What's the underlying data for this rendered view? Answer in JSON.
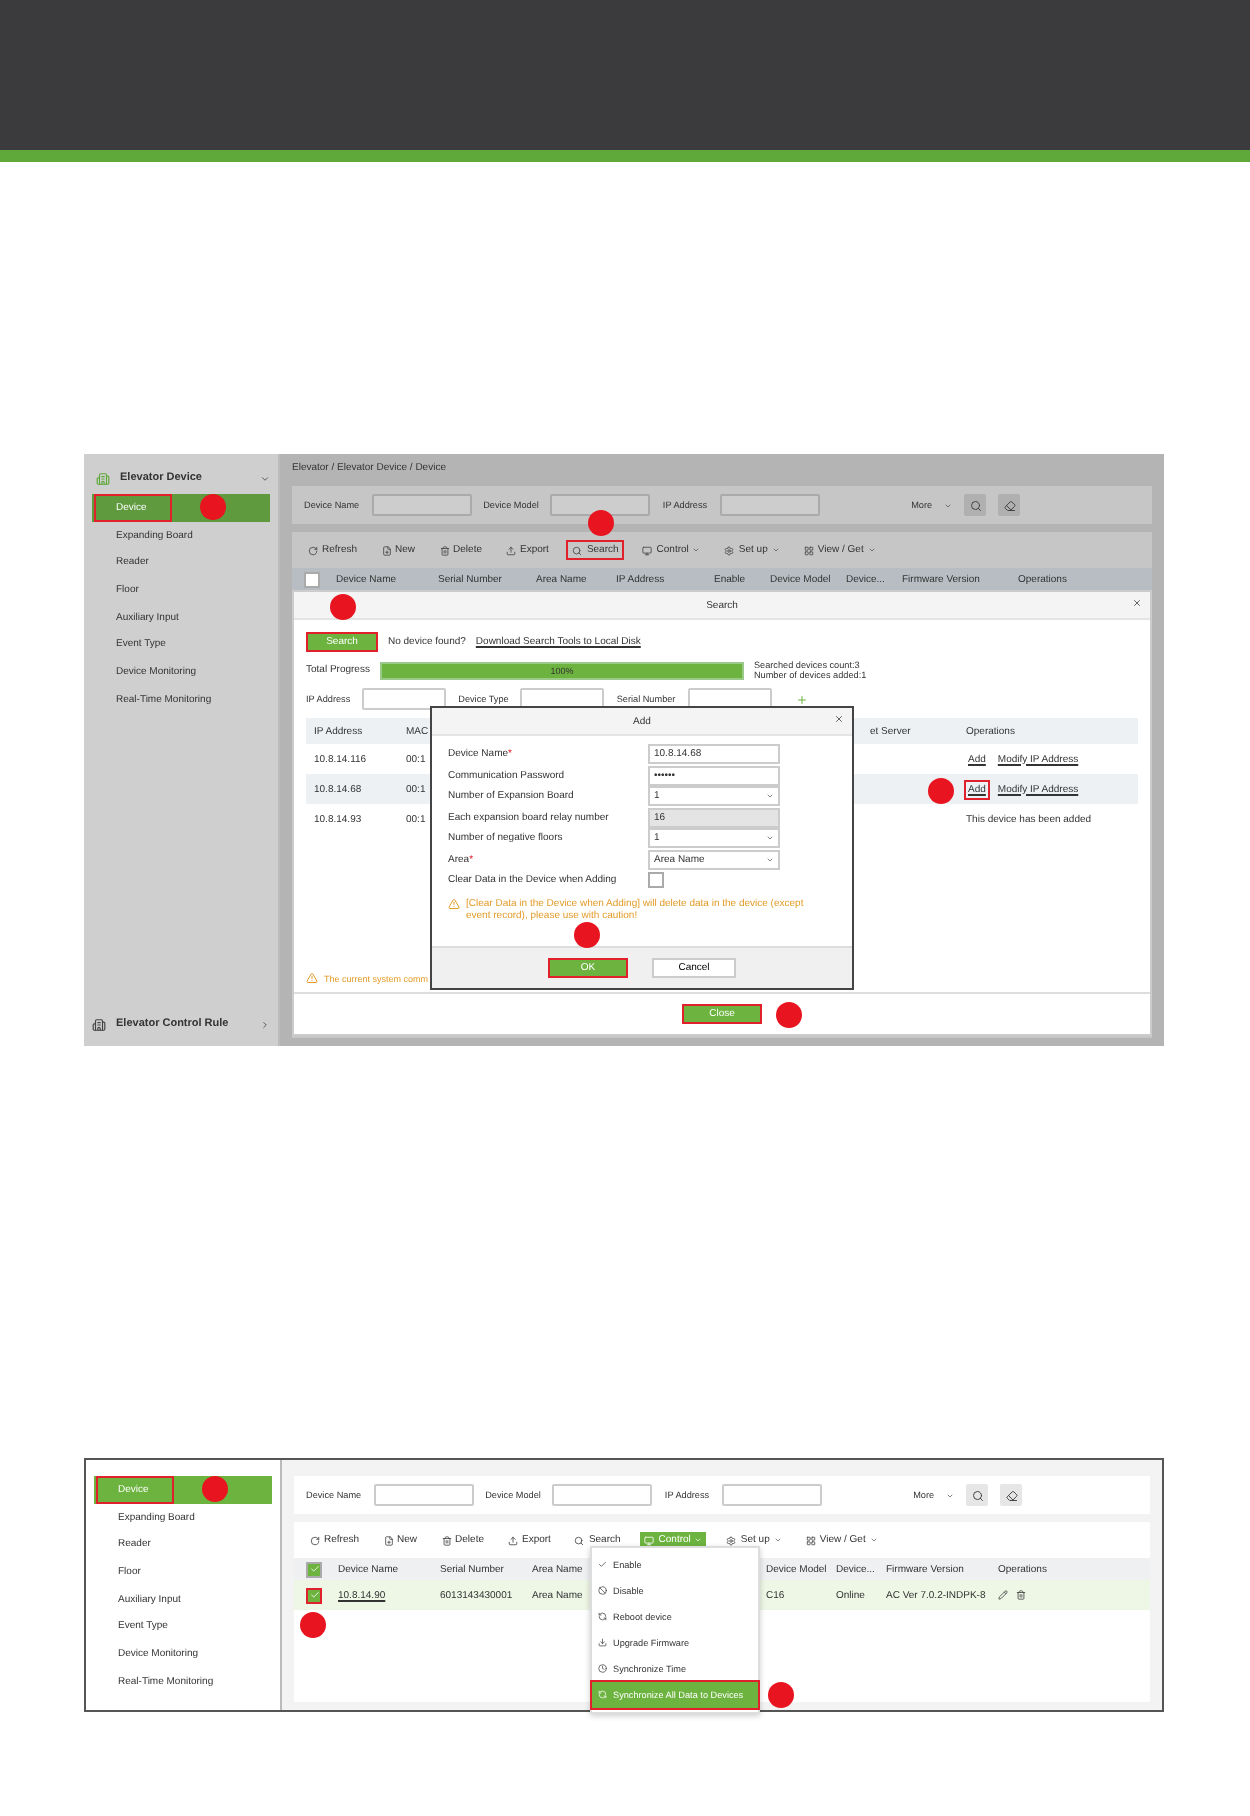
{
  "shot_1": {
    "sidebar": {
      "module": "Elevator Device",
      "items": [
        {
          "label": "Device",
          "selected": true,
          "highlighted": true
        },
        {
          "label": "Expanding Board",
          "selected": false,
          "highlighted": false
        },
        {
          "label": "Reader",
          "selected": false,
          "highlighted": false
        },
        {
          "label": "Floor",
          "selected": false,
          "highlighted": false
        },
        {
          "label": "Auxiliary Input",
          "selected": false,
          "highlighted": false
        },
        {
          "label": "Event Type",
          "selected": false,
          "highlighted": false
        },
        {
          "label": "Device Monitoring",
          "selected": false,
          "highlighted": false
        },
        {
          "label": "Real-Time Monitoring",
          "selected": false,
          "highlighted": false
        }
      ],
      "footer": "Elevator Control Rule"
    },
    "breadcrumb": "Elevator / Elevator Device / Device",
    "filters": [
      "Device Name",
      "Device Model",
      "IP Address"
    ],
    "more": "More",
    "toolbar": [
      {
        "label": "Refresh",
        "dropdown": false,
        "highlighted": false
      },
      {
        "label": "New",
        "dropdown": false,
        "highlighted": false
      },
      {
        "label": "Delete",
        "dropdown": false,
        "highlighted": false
      },
      {
        "label": "Export",
        "dropdown": false,
        "highlighted": false
      },
      {
        "label": "Search",
        "dropdown": false,
        "highlighted": true
      },
      {
        "label": "Control",
        "dropdown": true,
        "highlighted": false
      },
      {
        "label": "Set up",
        "dropdown": true,
        "highlighted": false
      },
      {
        "label": "View / Get",
        "dropdown": true,
        "highlighted": false
      }
    ],
    "header_checked": false,
    "columns": [
      "Device Name",
      "Serial Number",
      "Area Name",
      "IP Address",
      "Enable",
      "Device Model",
      "Device...",
      "Firmware Version",
      "Operations"
    ],
    "search_dialog": {
      "title": "Search",
      "search_button": {
        "label": "Search",
        "highlighted": true
      },
      "hint": "No device found?",
      "link": "Download Search Tools to Local Disk",
      "progress_label": "Total Progress",
      "level": 1,
      "progress_text": "100%",
      "counts": [
        "Searched devices count:3",
        "Number of devices added:1"
      ],
      "filters": [
        "IP Address",
        "Device Type",
        "Serial Number"
      ],
      "columns": [
        "IP Address",
        "MAC",
        "et Server",
        "Operations"
      ],
      "rows": [
        {
          "ip": "10.8.14.116",
          "mac": "00:1",
          "status": "",
          "ops": [
            {
              "label": "Add",
              "highlighted": false
            },
            {
              "label": "Modify IP Address",
              "highlighted": false
            }
          ]
        },
        {
          "ip": "10.8.14.68",
          "mac": "00:1",
          "status": "",
          "ops": [
            {
              "label": "Add",
              "highlighted": true
            },
            {
              "label": "Modify IP Address",
              "highlighted": false
            }
          ]
        },
        {
          "ip": "10.8.14.93",
          "mac": "00:1",
          "status": "This device has been added",
          "ops": []
        }
      ],
      "warning": "The current system comm",
      "close": {
        "label": "Close",
        "highlighted": true
      }
    },
    "add_dialog": {
      "title": "Add",
      "required_mark": "*",
      "fields": [
        {
          "label": "Device Name",
          "required": true,
          "kind": "text",
          "value": "10.8.14.68",
          "disabled": false
        },
        {
          "label": "Communication Password",
          "required": false,
          "kind": "text",
          "value": "••••••",
          "disabled": false
        },
        {
          "label": "Number of Expansion Board",
          "required": false,
          "kind": "select",
          "value": "1",
          "disabled": false
        },
        {
          "label": "Each expansion board relay number",
          "required": false,
          "kind": "text",
          "value": "16",
          "disabled": true
        },
        {
          "label": "Number of negative floors",
          "required": false,
          "kind": "select",
          "value": "1",
          "disabled": false
        },
        {
          "label": "Area",
          "required": true,
          "kind": "select",
          "value": "Area Name",
          "disabled": false
        },
        {
          "label": "Clear Data in the Device when Adding",
          "required": false,
          "kind": "checkbox",
          "checked": false,
          "disabled": false
        }
      ],
      "warning": "[Clear Data in the Device when Adding] will delete data in the device (except event record), please use with caution!",
      "ok": {
        "label": "OK",
        "highlighted": true
      },
      "cancel": "Cancel"
    }
  },
  "shot_2": {
    "sidebar": [
      {
        "label": "Device",
        "selected": true,
        "highlighted": true
      },
      {
        "label": "Expanding Board",
        "selected": false,
        "highlighted": false
      },
      {
        "label": "Reader",
        "selected": false,
        "highlighted": false
      },
      {
        "label": "Floor",
        "selected": false,
        "highlighted": false
      },
      {
        "label": "Auxiliary Input",
        "selected": false,
        "highlighted": false
      },
      {
        "label": "Event Type",
        "selected": false,
        "highlighted": false
      },
      {
        "label": "Device Monitoring",
        "selected": false,
        "highlighted": false
      },
      {
        "label": "Real-Time Monitoring",
        "selected": false,
        "highlighted": false
      }
    ],
    "filters": [
      "Device Name",
      "Device Model",
      "IP Address"
    ],
    "more": "More",
    "toolbar": [
      {
        "label": "Refresh",
        "dropdown": false,
        "selected": false
      },
      {
        "label": "New",
        "dropdown": false,
        "selected": false
      },
      {
        "label": "Delete",
        "dropdown": false,
        "selected": false
      },
      {
        "label": "Export",
        "dropdown": false,
        "selected": false
      },
      {
        "label": "Search",
        "dropdown": false,
        "selected": false
      },
      {
        "label": "Control",
        "dropdown": true,
        "selected": true
      },
      {
        "label": "Set up",
        "dropdown": true,
        "selected": false
      },
      {
        "label": "View / Get",
        "dropdown": true,
        "selected": false
      }
    ],
    "header_checked": true,
    "columns": [
      "Device Name",
      "Serial Number",
      "Area Name",
      "",
      "Device Model",
      "Device...",
      "Firmware Version",
      "Operations"
    ],
    "row": {
      "checked": true,
      "highlighted": true,
      "cells": [
        "10.8.14.90",
        "6013143430001",
        "Area Name",
        "",
        "C16",
        "Online",
        "AC Ver 7.0.2-INDPK-8"
      ]
    },
    "menu": [
      {
        "label": "Enable",
        "selected": false
      },
      {
        "label": "Disable",
        "selected": false
      },
      {
        "label": "Reboot device",
        "selected": false
      },
      {
        "label": "Upgrade Firmware",
        "selected": false
      },
      {
        "label": "Synchronize Time",
        "selected": false
      },
      {
        "label": "Synchronize All Data to Devices",
        "selected": true
      }
    ]
  }
}
